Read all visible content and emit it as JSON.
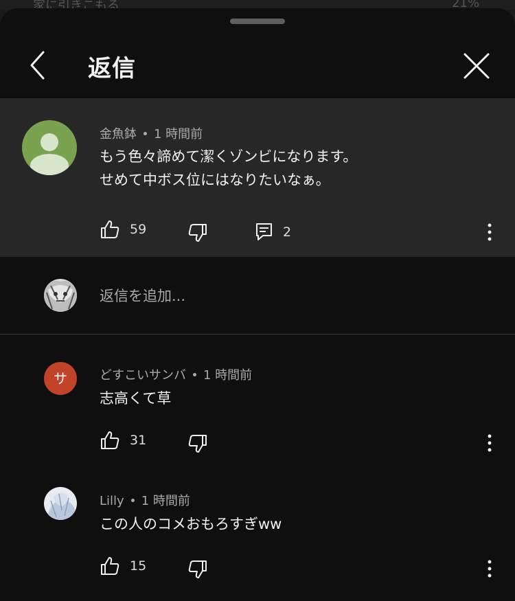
{
  "background_page": {
    "partial_text": "家に引きこもる",
    "partial_number": "21%"
  },
  "header": {
    "title": "返信"
  },
  "parent_comment": {
    "author": "金魚鉢",
    "time": "1 時間前",
    "text_line1": "もう色々諦めて潔くゾンビになります。",
    "text_line2": "せめて中ボス位にはなりたいなぁ。",
    "likes": "59",
    "replies": "2",
    "avatar_color": "#7aa350"
  },
  "add_reply": {
    "placeholder": "返信を追加..."
  },
  "replies": [
    {
      "author": "どすこいサンバ",
      "time": "1 時間前",
      "text": "志高くて草",
      "likes": "31",
      "avatar_initial": "サ",
      "avatar_color": "#c0432a"
    },
    {
      "author": "Lilly",
      "time": "1 時間前",
      "text": "この人のコメおもろすぎww",
      "likes": "15"
    }
  ],
  "icons": {
    "back": "chevron-left-icon",
    "close": "close-icon",
    "like": "thumbs-up-icon",
    "dislike": "thumbs-down-icon",
    "reply": "comment-icon",
    "more": "kebab-icon"
  }
}
